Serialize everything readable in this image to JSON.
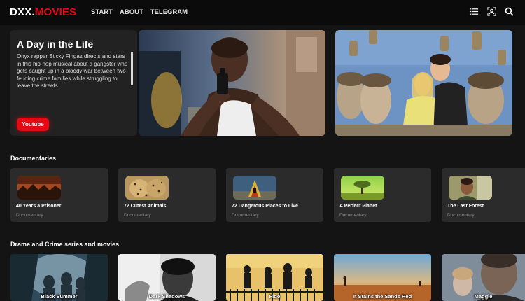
{
  "header": {
    "logo_part1": "DXX.",
    "logo_part2": "MOVIES",
    "nav": [
      "START",
      "ABOUT",
      "TELEGRAM"
    ],
    "icons": [
      "list-icon",
      "profile-icon",
      "search-icon"
    ]
  },
  "hero": {
    "title": "A Day in the Life",
    "description": "Onyx rapper Sticky Fingaz directs and stars in this hip-hop musical about a gangster who gets caught up in a bloody war between two feuding crime families while struggling to leave the streets.",
    "button_label": "Youtube"
  },
  "documentaries": {
    "title": "Documentaries",
    "items": [
      {
        "name": "40 Years a Prisoner",
        "category": "Documentary"
      },
      {
        "name": "72 Cutest Animals",
        "category": "Documentary"
      },
      {
        "name": "72 Dangerous Places to Live",
        "category": "Documentary"
      },
      {
        "name": "A Perfect Planet",
        "category": "Documentary"
      },
      {
        "name": "The Last Forest",
        "category": "Documentary"
      }
    ]
  },
  "drama": {
    "title": "Drame and Crime series and movies",
    "items": [
      {
        "name": "Black Summer"
      },
      {
        "name": "Dark Shadows"
      },
      {
        "name": "Fido"
      },
      {
        "name": "It Stains the Sands Red"
      },
      {
        "name": "Maggie"
      }
    ]
  },
  "colors": {
    "accent": "#e50914",
    "background": "#141414",
    "header": "#0b0b0b",
    "card": "#2b2b2b"
  }
}
